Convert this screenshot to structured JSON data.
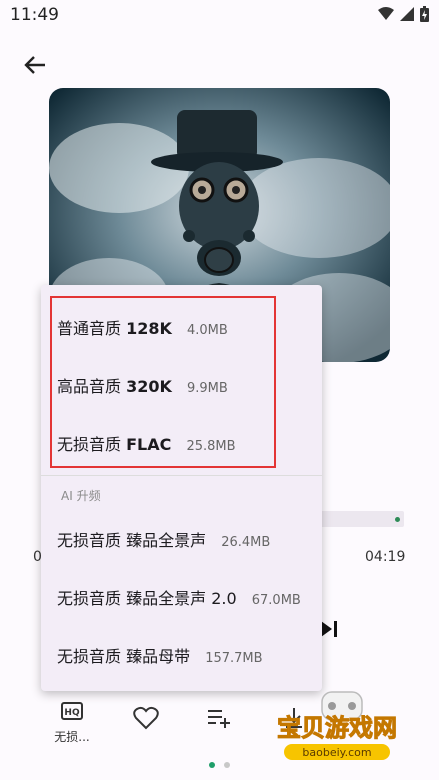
{
  "status": {
    "time": "11:49"
  },
  "player": {
    "time_elapsed": "0",
    "time_total": "04:19"
  },
  "bottom_bar": {
    "hq_label": "无损..."
  },
  "quality_menu": {
    "items": [
      {
        "name": "普通音质",
        "bitrate": "128K",
        "size": "4.0MB"
      },
      {
        "name": "高品音质",
        "bitrate": "320K",
        "size": "9.9MB"
      },
      {
        "name": "无损音质",
        "bitrate": "FLAC",
        "size": "25.8MB"
      }
    ],
    "ai_section_label": "AI 升频",
    "ai_items": [
      {
        "name": "无损音质",
        "tag": "臻品全景声",
        "size": "26.4MB"
      },
      {
        "name": "无损音质",
        "tag": "臻品全景声 2.0",
        "size": "67.0MB"
      },
      {
        "name": "无损音质",
        "tag": "臻品母带",
        "size": "157.7MB"
      }
    ]
  },
  "watermark": {
    "text": "宝贝游戏网",
    "url": "baobeiy.com"
  }
}
